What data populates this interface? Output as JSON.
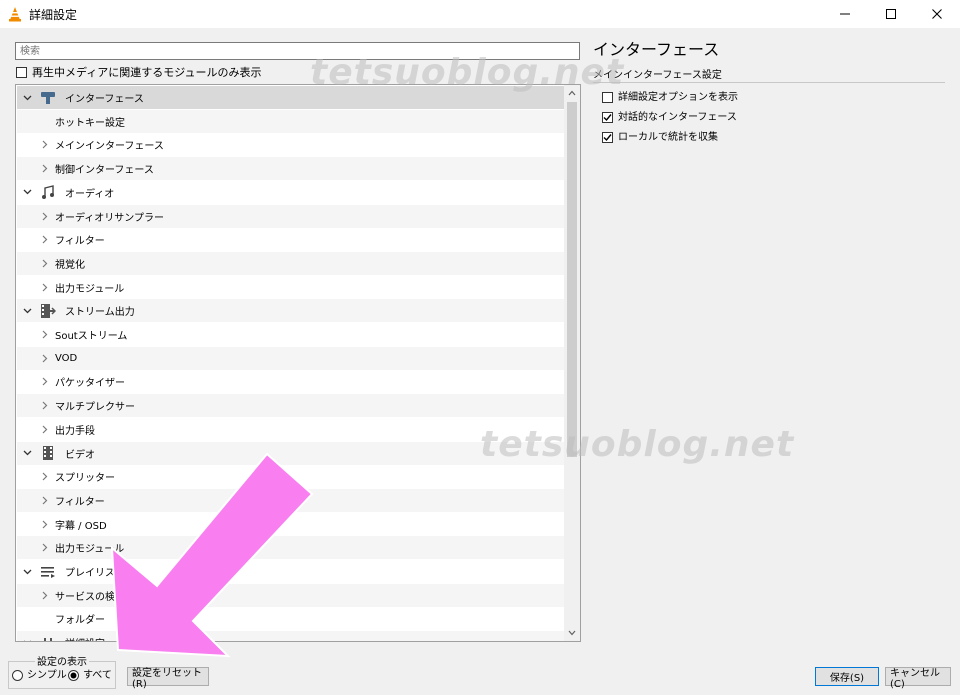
{
  "window": {
    "title": "詳細設定",
    "controls": [
      "minimize",
      "maximize",
      "close"
    ]
  },
  "left": {
    "search_placeholder": "検索",
    "filter_label": "再生中メディアに関連するモジュールのみ表示",
    "filter_checked": false
  },
  "tree": [
    {
      "label": "インターフェース",
      "level": 0,
      "expander": "expanded",
      "icon": "interface-icon",
      "selected": true
    },
    {
      "label": "ホットキー設定",
      "level": 1,
      "expander": "none"
    },
    {
      "label": "メインインターフェース",
      "level": 1,
      "expander": "collapsed"
    },
    {
      "label": "制御インターフェース",
      "level": 1,
      "expander": "collapsed"
    },
    {
      "label": "オーディオ",
      "level": 0,
      "expander": "expanded",
      "icon": "audio-icon"
    },
    {
      "label": "オーディオリサンプラー",
      "level": 1,
      "expander": "collapsed"
    },
    {
      "label": "フィルター",
      "level": 1,
      "expander": "collapsed"
    },
    {
      "label": "視覚化",
      "level": 1,
      "expander": "collapsed"
    },
    {
      "label": "出力モジュール",
      "level": 1,
      "expander": "collapsed"
    },
    {
      "label": "ストリーム出力",
      "level": 0,
      "expander": "expanded",
      "icon": "stream-output-icon"
    },
    {
      "label": "Soutストリーム",
      "level": 1,
      "expander": "collapsed"
    },
    {
      "label": "VOD",
      "level": 1,
      "expander": "collapsed"
    },
    {
      "label": "パケッタイザー",
      "level": 1,
      "expander": "collapsed"
    },
    {
      "label": "マルチプレクサー",
      "level": 1,
      "expander": "collapsed"
    },
    {
      "label": "出力手段",
      "level": 1,
      "expander": "collapsed"
    },
    {
      "label": "ビデオ",
      "level": 0,
      "expander": "expanded",
      "icon": "video-icon"
    },
    {
      "label": "スプリッター",
      "level": 1,
      "expander": "collapsed"
    },
    {
      "label": "フィルター",
      "level": 1,
      "expander": "collapsed"
    },
    {
      "label": "字幕 / OSD",
      "level": 1,
      "expander": "collapsed"
    },
    {
      "label": "出力モジュール",
      "level": 1,
      "expander": "collapsed"
    },
    {
      "label": "プレイリスト",
      "level": 0,
      "expander": "expanded",
      "icon": "playlist-icon"
    },
    {
      "label": "サービスの検出",
      "level": 1,
      "expander": "collapsed"
    },
    {
      "label": "フォルダー",
      "level": 1,
      "expander": "none"
    },
    {
      "label": "詳細設定",
      "level": 0,
      "expander": "expanded",
      "icon": "advanced-icon"
    }
  ],
  "right": {
    "title": "インターフェース",
    "subtitle": "メインインターフェース設定",
    "options": [
      {
        "label": "詳細設定オプションを表示",
        "checked": false
      },
      {
        "label": "対話的なインターフェース",
        "checked": true
      },
      {
        "label": "ローカルで統計を収集",
        "checked": true
      }
    ]
  },
  "bottom": {
    "group_title": "設定の表示",
    "radio_simple": "シンプル",
    "radio_all": "すべて",
    "selected_mode": "all",
    "reset_button": "設定をリセット(R)",
    "save_button": "保存(S)",
    "cancel_button": "キャンセル(C)"
  },
  "watermark": "tetsuoblog.net",
  "colors": {
    "vlc_orange": "#f28b00",
    "overlay_arrow": "#f97ef0",
    "selection": "#d9d9d9",
    "primary_border": "#0078d7"
  }
}
